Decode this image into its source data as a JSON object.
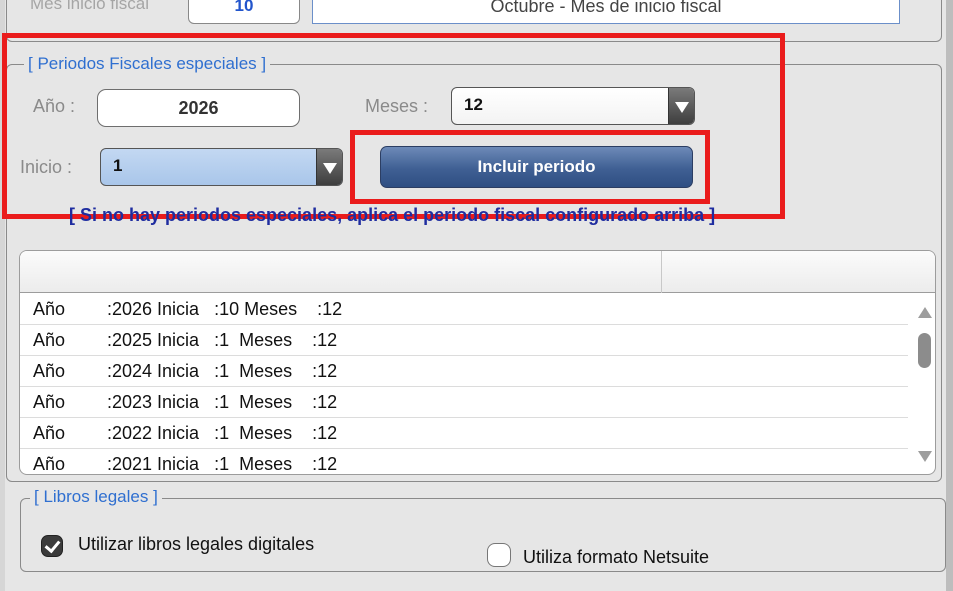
{
  "top_section": {
    "label": "Mes inicio fiscal",
    "month_number": "10",
    "month_text": "Octubre - Mes de inicio fiscal"
  },
  "periodos": {
    "legend": "[ Periodos Fiscales especiales ]",
    "anio_label": "Año :",
    "anio_value": "2026",
    "meses_label": "Meses :",
    "meses_value": "12",
    "inicio_label": "Inicio :",
    "inicio_value": "1",
    "incluir_button": "Incluir periodo",
    "note": "[ Si no hay periodos especiales, aplica el periodo fiscal configurado arriba ]"
  },
  "table": {
    "rows": [
      {
        "col1": "Año",
        "col2": ":2026 Inicia   :10 Meses    :12"
      },
      {
        "col1": "Año",
        "col2": ":2025 Inicia   :1  Meses    :12"
      },
      {
        "col1": "Año",
        "col2": ":2024 Inicia   :1  Meses    :12"
      },
      {
        "col1": "Año",
        "col2": ":2023 Inicia   :1  Meses    :12"
      },
      {
        "col1": "Año",
        "col2": ":2022 Inicia   :1  Meses    :12"
      },
      {
        "col1": "Año",
        "col2": ":2021 Inicia   :1  Meses    :12"
      }
    ]
  },
  "libros": {
    "legend": "[ Libros legales ]",
    "digital_label": "Utilizar libros legales digitales",
    "digital_checked": true,
    "netsuite_label": "Utiliza formato Netsuite",
    "netsuite_checked": false
  },
  "colors": {
    "highlight": "#ea1c1c",
    "legend_blue": "#2f6fd0",
    "note_blue": "#1f2da0",
    "button_blue": "#3f5f93"
  }
}
